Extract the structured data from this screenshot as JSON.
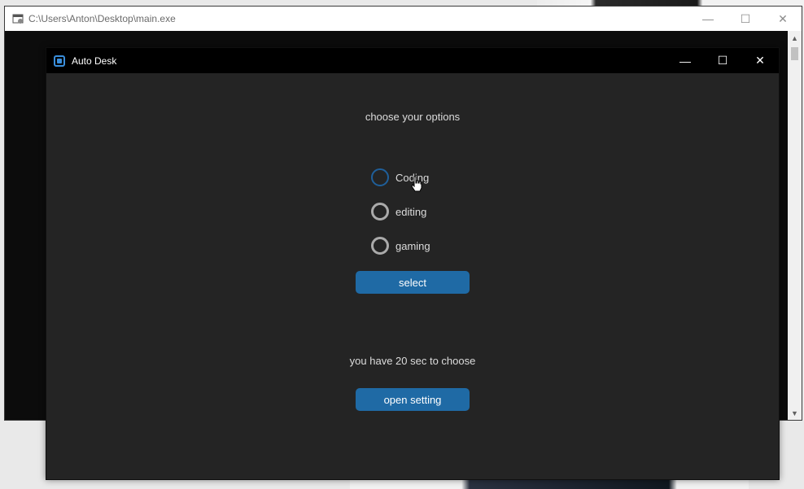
{
  "console": {
    "title": "C:\\Users\\Anton\\Desktop\\main.exe",
    "controls": {
      "minimize": "—",
      "maximize": "☐",
      "close": "✕"
    },
    "scroll_up": "▲",
    "scroll_down": "▼"
  },
  "app": {
    "title": "Auto Desk",
    "controls": {
      "minimize": "—",
      "maximize": "☐",
      "close": "✕"
    },
    "heading": "choose your options",
    "options": [
      {
        "label": "Coding",
        "state": "hover"
      },
      {
        "label": "editing",
        "state": "unselected"
      },
      {
        "label": "gaming",
        "state": "unselected"
      }
    ],
    "select_button": "select",
    "timer_text": "you have 20 sec to choose",
    "open_setting_button": "open setting"
  },
  "colors": {
    "accent": "#1f6aa5",
    "app_bg": "#242424",
    "titlebar_bg": "#000000",
    "text": "#dcdcdc"
  }
}
